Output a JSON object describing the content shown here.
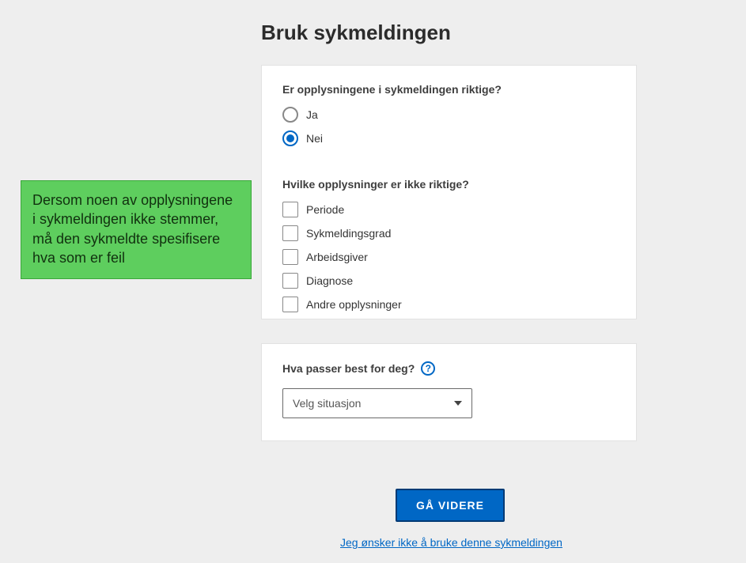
{
  "title": "Bruk sykmeldingen",
  "callout": "Dersom noen av opplysningene i sykmeldingen ikke stemmer, må den sykmeldte spesifisere hva som er feil",
  "q1": {
    "label": "Er opplysningene i sykmeldingen riktige?",
    "yes": "Ja",
    "no": "Nei"
  },
  "q2": {
    "label": "Hvilke opplysninger er ikke riktige?",
    "opts": {
      "periode": "Periode",
      "grad": "Sykmeldingsgrad",
      "arbeidsgiver": "Arbeidsgiver",
      "diagnose": "Diagnose",
      "andre": "Andre opplysninger"
    }
  },
  "q3": {
    "label": "Hva passer best for deg?",
    "placeholder": "Velg situasjon"
  },
  "actions": {
    "continue": "GÅ VIDERE",
    "decline": "Jeg ønsker ikke å bruke denne sykmeldingen"
  },
  "help_glyph": "?"
}
